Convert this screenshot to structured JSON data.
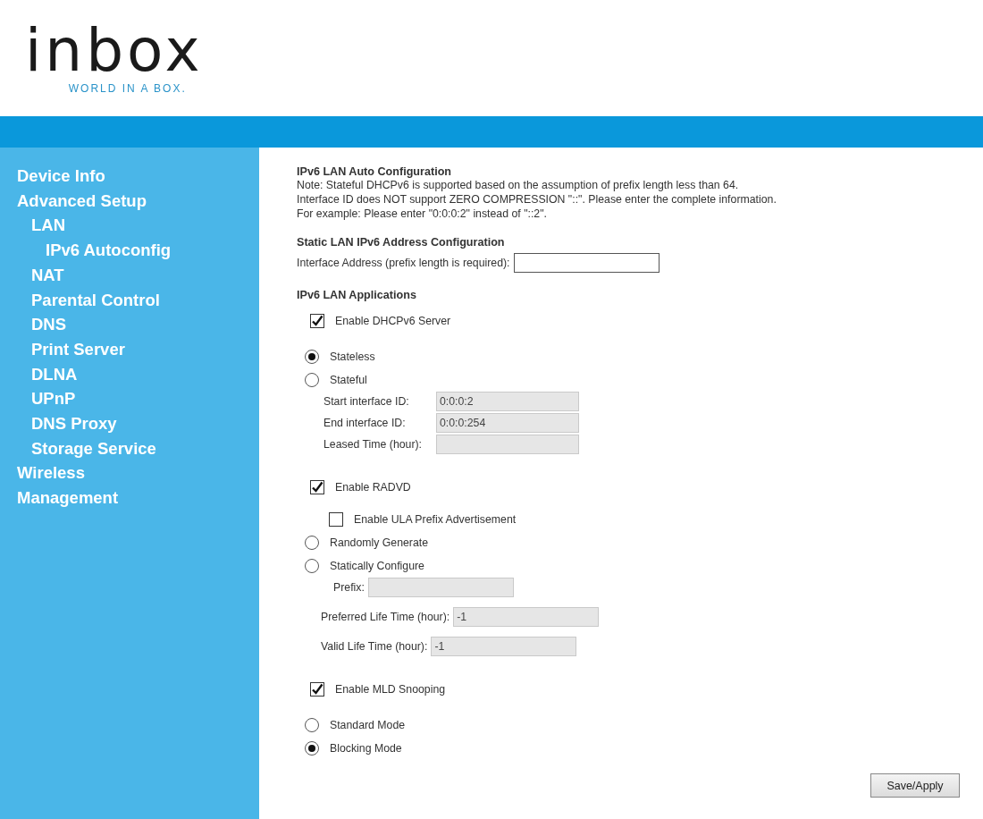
{
  "logo": {
    "wordmark": "inbox",
    "tagline": "WORLD IN A BOX."
  },
  "sidebar": {
    "items": [
      {
        "label": "Device Info"
      },
      {
        "label": "Advanced Setup",
        "children": [
          {
            "label": "LAN",
            "children": [
              {
                "label": "IPv6 Autoconfig"
              }
            ]
          },
          {
            "label": "NAT"
          },
          {
            "label": "Parental Control"
          },
          {
            "label": "DNS"
          },
          {
            "label": "Print Server"
          },
          {
            "label": "DLNA"
          },
          {
            "label": "UPnP"
          },
          {
            "label": "DNS Proxy"
          },
          {
            "label": "Storage Service"
          }
        ]
      },
      {
        "label": "Wireless"
      },
      {
        "label": "Management"
      }
    ]
  },
  "content": {
    "sections": [
      {
        "heading": "IPv6 LAN Auto Configuration",
        "note_lines": [
          "Note: Stateful DHCPv6 is supported based on the assumption of prefix length less than 64.",
          "Interface ID does NOT support ZERO COMPRESSION \"::\". Please enter the complete information.",
          "For example: Please enter \"0:0:0:2\" instead of \"::2\"."
        ]
      },
      {
        "heading": "Static LAN IPv6 Address Configuration",
        "items": [
          {
            "kind": "field",
            "label": "Interface Address (prefix length is required):",
            "disabled": false
          }
        ]
      },
      {
        "heading": "IPv6 LAN Applications",
        "items": [
          {
            "kind": "checkbox",
            "label": "Enable DHCPv6 Server",
            "checked": true
          },
          {
            "kind": "radio",
            "label": "Stateless",
            "selected": true
          },
          {
            "kind": "radio",
            "label": "Stateful",
            "selected": false,
            "fields": [
              {
                "kind": "aligned",
                "label": "Start interface ID:",
                "value": "0:0:0:2",
                "disabled": true
              },
              {
                "kind": "aligned",
                "label": "End interface ID:",
                "value": "0:0:0:254",
                "disabled": true
              },
              {
                "kind": "aligned",
                "label": "Leased Time (hour):",
                "disabled": true
              }
            ]
          },
          {
            "kind": "checkbox",
            "label": "Enable RADVD",
            "checked": true,
            "children": [
              {
                "kind": "checkbox",
                "label": "Enable ULA Prefix Advertisement",
                "checked": false
              }
            ]
          },
          {
            "kind": "radio",
            "label": "Randomly Generate",
            "selected": false
          },
          {
            "kind": "radio",
            "label": "Statically Configure",
            "selected": false,
            "fields": [
              {
                "kind": "inline",
                "label": "Prefix:",
                "disabled": true
              },
              {
                "kind": "inline",
                "label": "Preferred Life Time (hour):",
                "value": "-1",
                "disabled": true
              },
              {
                "kind": "inline",
                "label": "Valid Life Time (hour):",
                "value": "-1",
                "disabled": true
              }
            ]
          },
          {
            "kind": "checkbox",
            "label": "Enable MLD Snooping",
            "checked": true
          },
          {
            "kind": "radio",
            "label": "Standard Mode",
            "selected": false
          },
          {
            "kind": "radio",
            "label": "Blocking Mode",
            "selected": true
          }
        ]
      }
    ],
    "buttons": [
      "Save/Apply"
    ]
  }
}
